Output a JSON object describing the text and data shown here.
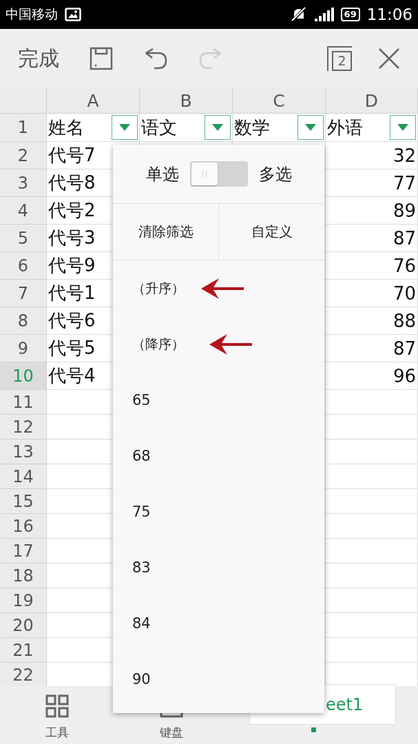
{
  "status_bar": {
    "carrier": "中国移动",
    "battery": "69",
    "time": "11:06"
  },
  "toolbar": {
    "done": "完成",
    "window_count": "2"
  },
  "sheet": {
    "columns": [
      "A",
      "B",
      "C",
      "D"
    ],
    "rows": [
      {
        "number": "1",
        "kind": "header",
        "selected": false,
        "cells": [
          "姓名",
          "语文",
          "数学",
          "外语"
        ]
      },
      {
        "number": "2",
        "kind": "data",
        "selected": false,
        "name": "代号7",
        "score": "32"
      },
      {
        "number": "3",
        "kind": "data",
        "selected": false,
        "name": "代号8",
        "score": "77"
      },
      {
        "number": "4",
        "kind": "data",
        "selected": false,
        "name": "代号2",
        "score": "89"
      },
      {
        "number": "5",
        "kind": "data",
        "selected": false,
        "name": "代号3",
        "score": "87"
      },
      {
        "number": "6",
        "kind": "data",
        "selected": false,
        "name": "代号9",
        "score": "76"
      },
      {
        "number": "7",
        "kind": "data",
        "selected": false,
        "name": "代号1",
        "score": "70"
      },
      {
        "number": "8",
        "kind": "data",
        "selected": false,
        "name": "代号6",
        "score": "88"
      },
      {
        "number": "9",
        "kind": "data",
        "selected": false,
        "name": "代号5",
        "score": "87"
      },
      {
        "number": "10",
        "kind": "data",
        "selected": true,
        "name": "代号4",
        "score": "96"
      },
      {
        "number": "11",
        "kind": "empty",
        "selected": false
      },
      {
        "number": "12",
        "kind": "empty",
        "selected": false
      },
      {
        "number": "13",
        "kind": "empty",
        "selected": false
      },
      {
        "number": "14",
        "kind": "empty",
        "selected": false
      },
      {
        "number": "15",
        "kind": "empty",
        "selected": false
      },
      {
        "number": "16",
        "kind": "empty",
        "selected": false
      },
      {
        "number": "17",
        "kind": "empty",
        "selected": false
      },
      {
        "number": "18",
        "kind": "empty",
        "selected": false
      },
      {
        "number": "19",
        "kind": "empty",
        "selected": false
      },
      {
        "number": "20",
        "kind": "empty",
        "selected": false
      },
      {
        "number": "21",
        "kind": "empty",
        "selected": false
      },
      {
        "number": "22",
        "kind": "empty",
        "selected": false
      }
    ]
  },
  "filter_popup": {
    "single_label": "单选",
    "multi_label": "多选",
    "multi_select": false,
    "clear": "清除筛选",
    "custom": "自定义",
    "sort_options": [
      "（升序）",
      "（降序）"
    ],
    "values": [
      "65",
      "68",
      "75",
      "83",
      "84",
      "90"
    ]
  },
  "bottom_bar": {
    "tools": "工具",
    "keyboard": "键盘",
    "sheet_tab": "eet1"
  }
}
